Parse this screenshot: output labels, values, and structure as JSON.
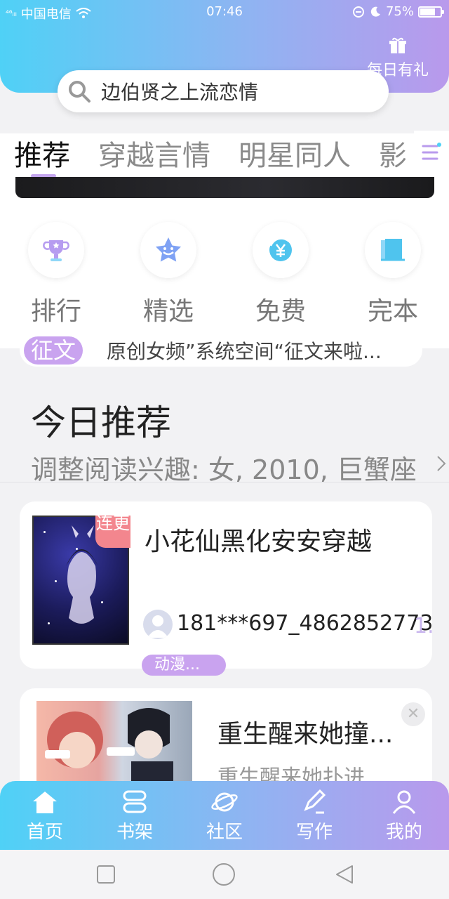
{
  "status_bar": {
    "signal": "⁴⁶ᵢₗₗ",
    "carrier": "中国电信",
    "time": "07:46",
    "battery": "75%",
    "battery_level": 0.75
  },
  "header": {
    "gift_label": "每日有礼",
    "search_text": "边伯贤之上流恋情"
  },
  "tabs": [
    {
      "label": "推荐"
    },
    {
      "label": "穿越言情"
    },
    {
      "label": "明星同人"
    },
    {
      "label": "影"
    }
  ],
  "quick_nav": [
    {
      "label": "排行",
      "icon": "trophy-icon"
    },
    {
      "label": "精选",
      "icon": "star-icon"
    },
    {
      "label": "免费",
      "icon": "yuan-icon"
    },
    {
      "label": "完本",
      "icon": "book-icon"
    }
  ],
  "notice": {
    "badge": "征文",
    "text": "原创女频”系统空间“征文来啦..."
  },
  "today": {
    "title": "今日推荐",
    "interest": "调整阅读兴趣: 女, 2010, 巨蟹座"
  },
  "books": [
    {
      "title": "小花仙黑化安安穿越",
      "tag": "连更",
      "author": "181***697_4862852773",
      "author_more": "1.",
      "genre": "动漫..."
    },
    {
      "title": "重生醒来她撞...",
      "subtitle": "重生醒来她扑进"
    }
  ],
  "bottom_nav": [
    {
      "label": "首页",
      "icon": "home-icon"
    },
    {
      "label": "书架",
      "icon": "bookshelf-icon"
    },
    {
      "label": "社区",
      "icon": "planet-icon"
    },
    {
      "label": "写作",
      "icon": "pen-icon"
    },
    {
      "label": "我的",
      "icon": "user-icon"
    }
  ],
  "colors": {
    "accent_gradient_start": "#4fd1f6",
    "accent_gradient_end": "#b999ec",
    "purple_badge": "#c9a3ef",
    "tag_red": "#f3868e"
  }
}
